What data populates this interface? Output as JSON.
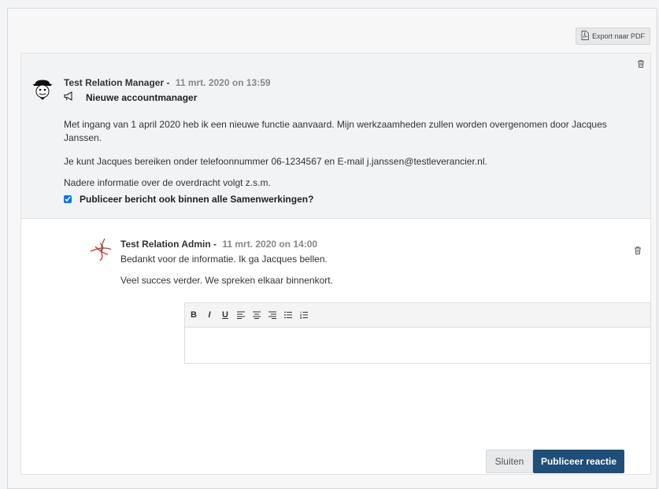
{
  "toolbar": {
    "export_label": "Export naar PDF"
  },
  "post": {
    "author": "Test Relation Manager -",
    "date": "11 mrt. 2020 on 13:59",
    "subject": "Nieuwe accountmanager",
    "paragraphs": [
      "Met ingang van 1 april 2020 heb ik een nieuwe functie aanvaard. Mijn werkzaamheden zullen worden overgenomen door Jacques Janssen.",
      "Je kunt Jacques bereiken onder telefoonnummer 06-1234567 en E-mail j.janssen@testleverancier.nl.",
      "Nadere informatie over de overdracht volgt z.s.m."
    ],
    "publish_checkbox_label": "Publiceer bericht ook binnen alle Samenwerkingen?",
    "publish_checked": true
  },
  "reply": {
    "author": "Test Relation Admin -",
    "date": "11 mrt. 2020 on 14:00",
    "lines": [
      "Bedankt voor de informatie. Ik ga Jacques bellen.",
      "Veel succes verder. We spreken elkaar binnenkort."
    ]
  },
  "editor": {
    "tools": [
      "B",
      "I",
      "U",
      "align-left-icon",
      "align-center-icon",
      "align-right-icon",
      "bullet-list-icon",
      "numbered-list-icon"
    ],
    "value": ""
  },
  "actions": {
    "close_label": "Sluiten",
    "publish_label": "Publiceer reactie"
  },
  "colors": {
    "primary": "#1f4e79",
    "post_bg": "#f2f3f5"
  }
}
